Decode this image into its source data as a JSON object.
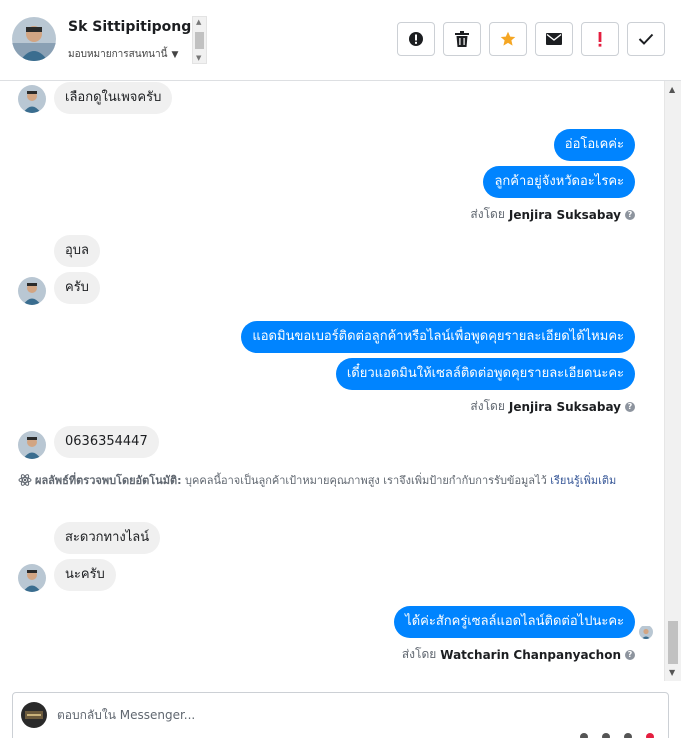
{
  "header": {
    "name": "Sk Sittipitipong",
    "assign_label": "มอบหมายการสนทนานี้"
  },
  "actions": [
    {
      "name": "mark-spam-button",
      "icon": "alert-circle-icon"
    },
    {
      "name": "delete-button",
      "icon": "trash-icon"
    },
    {
      "name": "star-button",
      "icon": "star-icon",
      "color": "#f5a623"
    },
    {
      "name": "mark-unread-button",
      "icon": "envelope-icon"
    },
    {
      "name": "flag-important-button",
      "icon": "exclamation-icon",
      "color": "#e41e3f"
    },
    {
      "name": "mark-done-button",
      "icon": "check-icon"
    }
  ],
  "messages": {
    "m1": "เลือกดูในเพจครับ",
    "m2": "อ่อโอเคค่ะ",
    "m3": "ลูกค้าอยู่จังหวัดอะไรคะ",
    "m4": "อุบล",
    "m5": "ครับ",
    "m6": "แอดมินขอเบอร์ติดต่อลูกค้าหรือไลน์เพื่อพูดคุยรายละเอียดได้ไหมคะ",
    "m7": "เดี๋ยวแอดมินให้เซลล์ติดต่อพูดคุยรายละเอียดนะคะ",
    "m8": "0636354447",
    "m9": "สะดวกทางไลน์",
    "m10": "นะครับ",
    "m11": "ได้ค่ะสักครู่เซลล์แอดไลน์ติดต่อไปนะคะ"
  },
  "sent_by": {
    "prefix": "ส่งโดย",
    "s1": "Jenjira Suksabay",
    "s2": "Jenjira Suksabay",
    "s3": "Watcharin Chanpanyachon"
  },
  "auto_note": {
    "label": "ผลลัพธ์ที่ตรวจพบโดยอัตโนมัติ:",
    "text": "บุคคลนี้อาจเป็นลูกค้าเป้าหมายคุณภาพสูง เราจึงเพิ่มป้ายกำกับการรับข้อมูลไว้",
    "link": "เรียนรู้เพิ่มเติม"
  },
  "composer": {
    "placeholder": "ตอบกลับใน Messenger..."
  },
  "colors": {
    "outgoing": "#0084ff",
    "incoming": "#f0f0f0",
    "link": "#385898"
  }
}
